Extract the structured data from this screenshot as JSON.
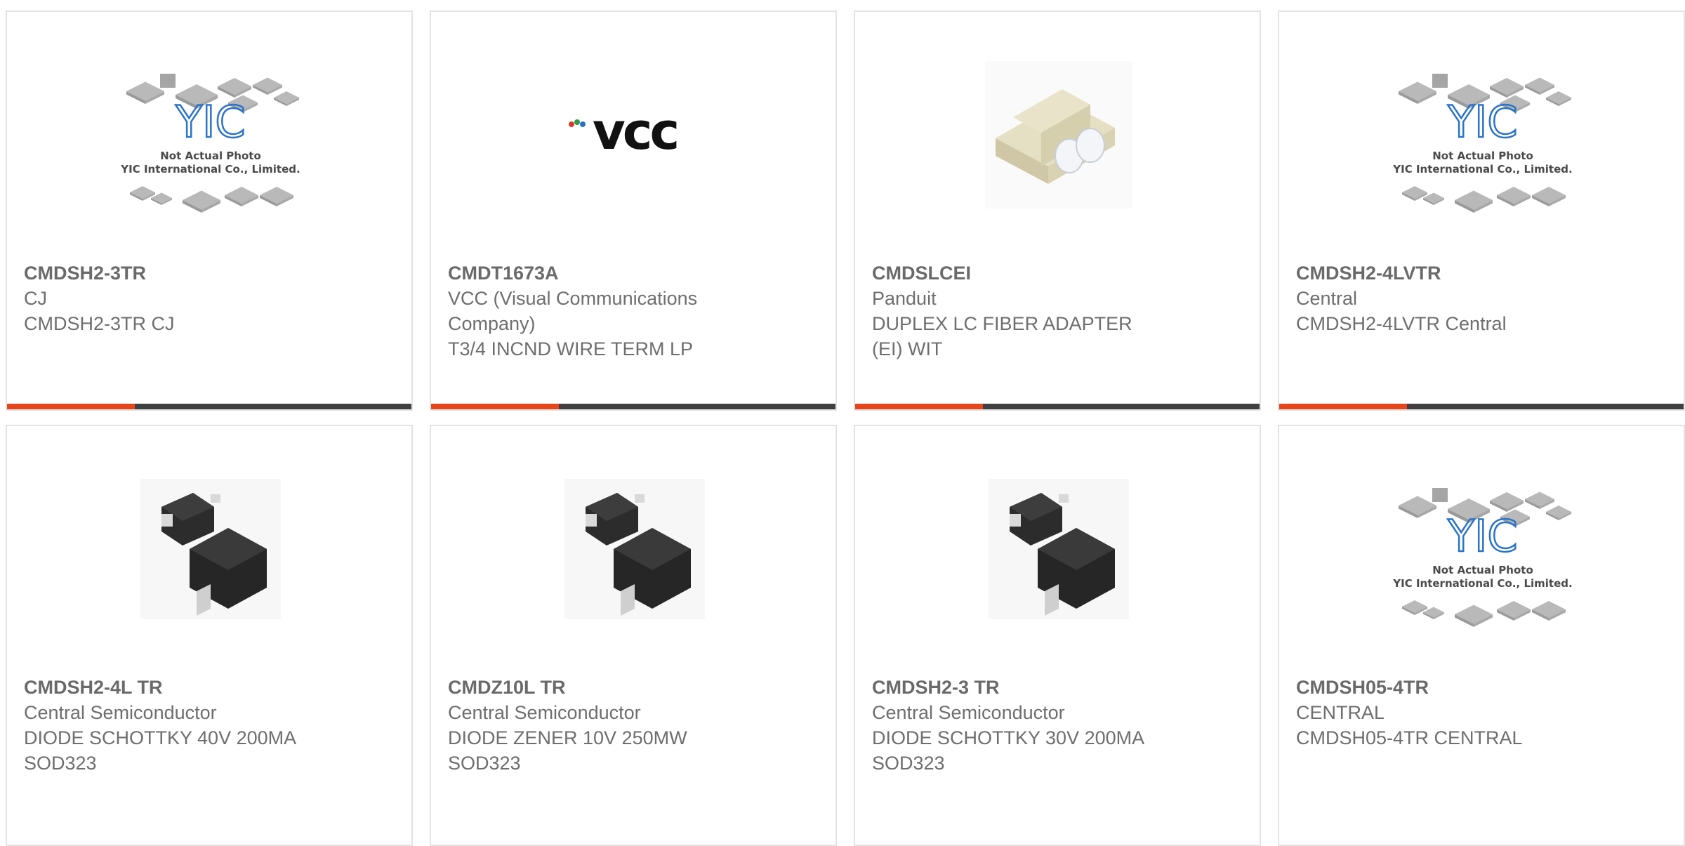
{
  "placeholder": {
    "line1": "Not Actual Photo",
    "line2": "YIC International Co., Limited.",
    "logo_text": "YIC"
  },
  "vcc_logo_text": "vcc",
  "cards": [
    {
      "part_number": "CMDSH2-3TR",
      "manufacturer": "CJ",
      "desc1": "CMDSH2-3TR CJ",
      "desc2": "",
      "image": "yic-placeholder"
    },
    {
      "part_number": "CMDT1673A",
      "manufacturer": "VCC (Visual Communications",
      "manufacturer2": "Company)",
      "desc1": "T3/4 INCND WIRE TERM LP",
      "desc2": "",
      "image": "vcc-logo"
    },
    {
      "part_number": "CMDSLCEI",
      "manufacturer": "Panduit",
      "desc1": "DUPLEX LC FIBER ADAPTER",
      "desc2": "(EI) WIT",
      "image": "fiber-adapter"
    },
    {
      "part_number": "CMDSH2-4LVTR",
      "manufacturer": "Central",
      "desc1": "CMDSH2-4LVTR Central",
      "desc2": "",
      "image": "yic-placeholder"
    },
    {
      "part_number": "CMDSH2-4L TR",
      "manufacturer": "Central Semiconductor",
      "desc1": "DIODE SCHOTTKY 40V 200MA",
      "desc2": "SOD323",
      "image": "sod323-package"
    },
    {
      "part_number": "CMDZ10L TR",
      "manufacturer": "Central Semiconductor",
      "desc1": "DIODE ZENER 10V 250MW",
      "desc2": "SOD323",
      "image": "sod323-package"
    },
    {
      "part_number": "CMDSH2-3 TR",
      "manufacturer": "Central Semiconductor",
      "desc1": "DIODE SCHOTTKY 30V 200MA",
      "desc2": "SOD323",
      "image": "sod323-package"
    },
    {
      "part_number": "CMDSH05-4TR",
      "manufacturer": "CENTRAL",
      "desc1": "CMDSH05-4TR CENTRAL",
      "desc2": "",
      "image": "yic-placeholder"
    }
  ],
  "colors": {
    "accent": "#e8461a",
    "bar": "#404040",
    "border": "#e3e3e3",
    "text": "#6e6e6e"
  }
}
